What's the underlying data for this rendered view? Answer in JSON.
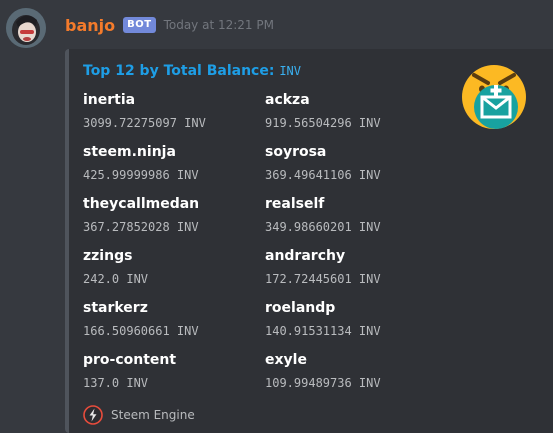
{
  "message": {
    "username": "banjo",
    "bot_tag": "BOT",
    "timestamp": "Today at 12:21 PM"
  },
  "embed": {
    "title_prefix": "Top 12 by Total Balance:",
    "title_code": "INV",
    "fields": [
      {
        "name": "inertia",
        "value": "3099.72275097 INV"
      },
      {
        "name": "ackza",
        "value": "919.56504296 INV"
      },
      {
        "name": "steem.ninja",
        "value": "425.99999986 INV"
      },
      {
        "name": "soyrosa",
        "value": "369.49641106 INV"
      },
      {
        "name": "theycallmedan",
        "value": "367.27852028 INV"
      },
      {
        "name": "realself",
        "value": "349.98660201 INV"
      },
      {
        "name": "zzings",
        "value": "242.0 INV"
      },
      {
        "name": "andrarchy",
        "value": "172.72445601 INV"
      },
      {
        "name": "starkerz",
        "value": "166.50960661 INV"
      },
      {
        "name": "roelandp",
        "value": "140.91531134 INV"
      },
      {
        "name": "pro-content",
        "value": "137.0 INV"
      },
      {
        "name": "exyle",
        "value": "109.99489736 INV"
      }
    ],
    "footer_text": "Steem Engine",
    "footer_icon": "steem-engine-icon",
    "thumbnail_icon": "mail-plus-icon"
  },
  "colors": {
    "background": "#36393f",
    "embed_background": "#2f3136",
    "username": "#f47b2b",
    "title": "#1e9ee6",
    "bot_tag": "#7289da",
    "thumbnail_circle": "#18a2a0",
    "thumbnail_face": "#fcb923"
  }
}
